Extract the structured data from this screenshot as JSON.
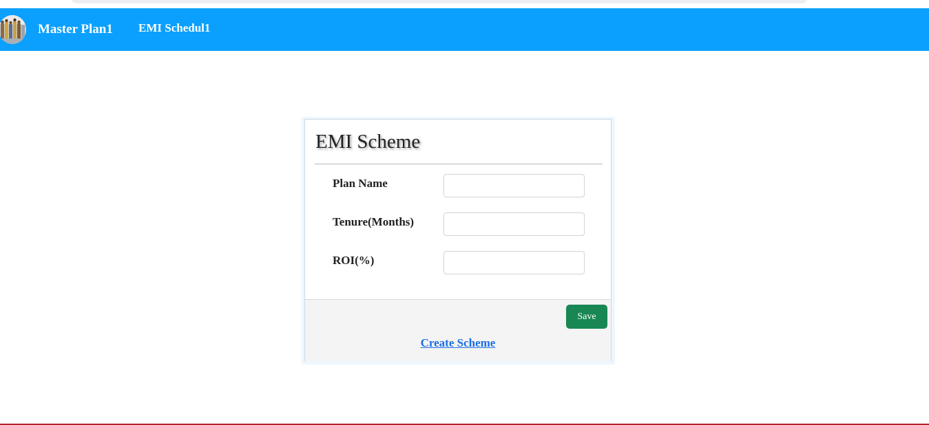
{
  "navbar": {
    "background": "#0ba0fe",
    "avatar_icon": "user-photo-avatar",
    "links": [
      {
        "label": "Master Plan1"
      },
      {
        "label": "EMI Schedul1"
      }
    ]
  },
  "form": {
    "title": "EMI Scheme",
    "fields": [
      {
        "label": "Plan Name",
        "value": "",
        "placeholder": ""
      },
      {
        "label": "Tenure(Months)",
        "value": "",
        "placeholder": ""
      },
      {
        "label": "ROI(%)",
        "value": "",
        "placeholder": ""
      }
    ],
    "save_label": "Save",
    "save_color": "#198754",
    "create_link_label": "Create Scheme",
    "link_color": "#1a6ee6"
  }
}
